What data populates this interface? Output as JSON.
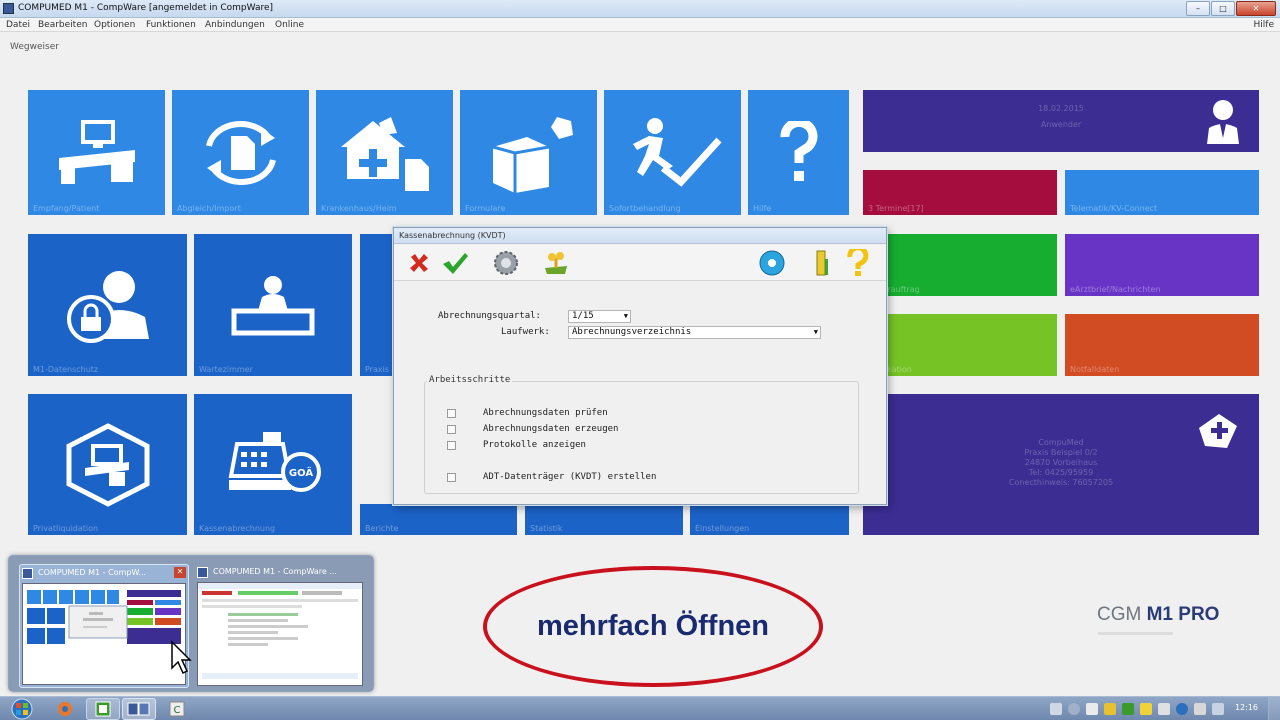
{
  "window": {
    "title": "COMPUMED M1  -  CompWare [angemeldet in CompWare]",
    "buttons": [
      "–",
      "□",
      "✕"
    ]
  },
  "menu": {
    "items": [
      "Datei",
      "Bearbeiten",
      "Optionen",
      "Funktionen",
      "Anbindungen",
      "Online"
    ],
    "help": "Hilfe"
  },
  "wegweiser": "Wegweiser",
  "tiles": {
    "t1": "Empfang/Patient",
    "t2": "Abgleich/Import",
    "t3": "Krankenhaus/Heim",
    "t4": "Formulare",
    "t5": "Sofortbehandlung",
    "t6": "Hilfe",
    "t7": "M1-Datenschutz",
    "t8": "Wartezimmer",
    "t9": "Praxis",
    "t10": "Privatliquidation",
    "t11": "Kassenabrechnung",
    "t12": "Berichte",
    "t13": "Statistik",
    "t14": "Einstellungen",
    "user_date": "18.02.2015",
    "user_name": "Anwender",
    "termine": "3 Termine[17]",
    "t_blue2": "Telematik/KV-Connect",
    "t_green1": "Laborauftrag",
    "t_violet": "eArztbrief/Nachrichten",
    "t_lgreen": "Medikation",
    "t_orange": "Notfalldaten",
    "practice": [
      "CompuMed",
      "Praxis Beispiel 0/2",
      "24870 Vorbeihaus",
      "Tel: 0425/95959",
      "Conecthinweis: 76057205"
    ]
  },
  "dialog": {
    "title": "Kassenabrechnung (KVDT)",
    "quartal_label": "Abrechnungsquartal:",
    "quartal_value": "1/15",
    "laufwerk_label": "Laufwerk:",
    "laufwerk_value": "Abrechnungsverzeichnis",
    "group_label": "Arbeitsschritte",
    "steps": [
      "Abrechnungsdaten prüfen",
      "Abrechnungsdaten erzeugen",
      "Protokolle anzeigen",
      "ADT-Datenträger (KVDT) erstellen"
    ]
  },
  "thumbnails": {
    "one": "COMPUMED M1  -  CompW...",
    "two": "COMPUMED M1  -  CompWare ..."
  },
  "annotation": "mehrfach Öffnen",
  "brand": {
    "cgm": "CGM",
    "product": "M1 PRO"
  },
  "taskbar": {
    "clock": "12:16"
  }
}
